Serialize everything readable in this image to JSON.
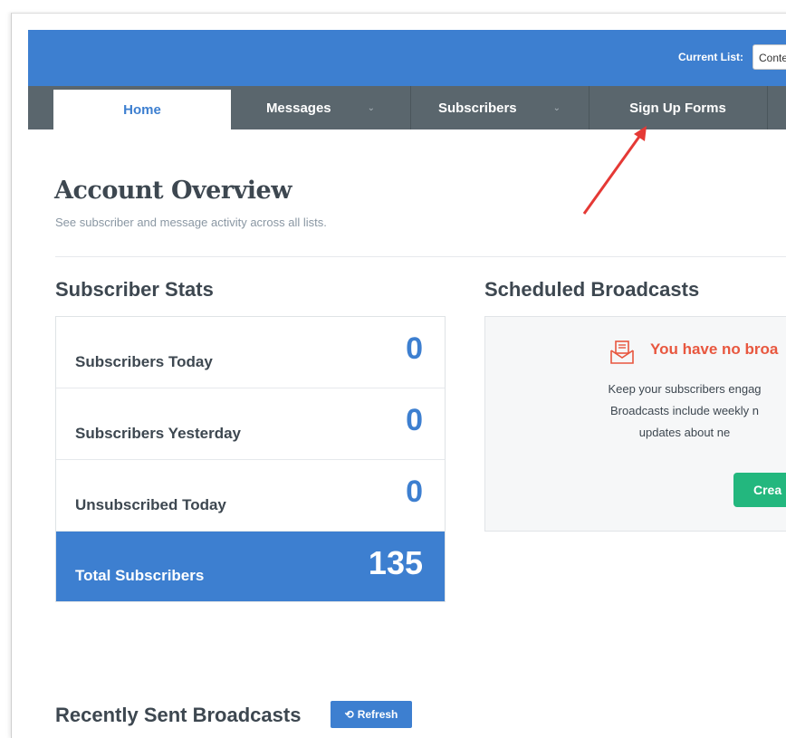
{
  "header": {
    "current_list_label": "Current List:",
    "current_list_value": "Conte"
  },
  "nav": {
    "items": [
      {
        "label": "Home"
      },
      {
        "label": "Messages"
      },
      {
        "label": "Subscribers"
      },
      {
        "label": "Sign Up Forms"
      }
    ]
  },
  "page": {
    "title": "Account Overview",
    "subtitle": "See subscriber and message activity across all lists."
  },
  "subscriber_stats": {
    "title": "Subscriber Stats",
    "rows": [
      {
        "label": "Subscribers Today",
        "value": "0"
      },
      {
        "label": "Subscribers Yesterday",
        "value": "0"
      },
      {
        "label": "Unsubscribed Today",
        "value": "0"
      }
    ],
    "total": {
      "label": "Total Subscribers",
      "value": "135"
    }
  },
  "scheduled": {
    "title": "Scheduled Broadcasts",
    "empty_title": "You have no broa",
    "desc_line1": "Keep your subscribers engag",
    "desc_line2": "Broadcasts include weekly n",
    "desc_line3": "updates about ne",
    "create_label": "Crea"
  },
  "recent": {
    "title": "Recently Sent Broadcasts",
    "refresh_label": "Refresh"
  },
  "colors": {
    "primary": "#3d7fd0",
    "nav_bg": "#5a666d",
    "accent_red": "#e8573f",
    "create_green": "#23b77e"
  }
}
